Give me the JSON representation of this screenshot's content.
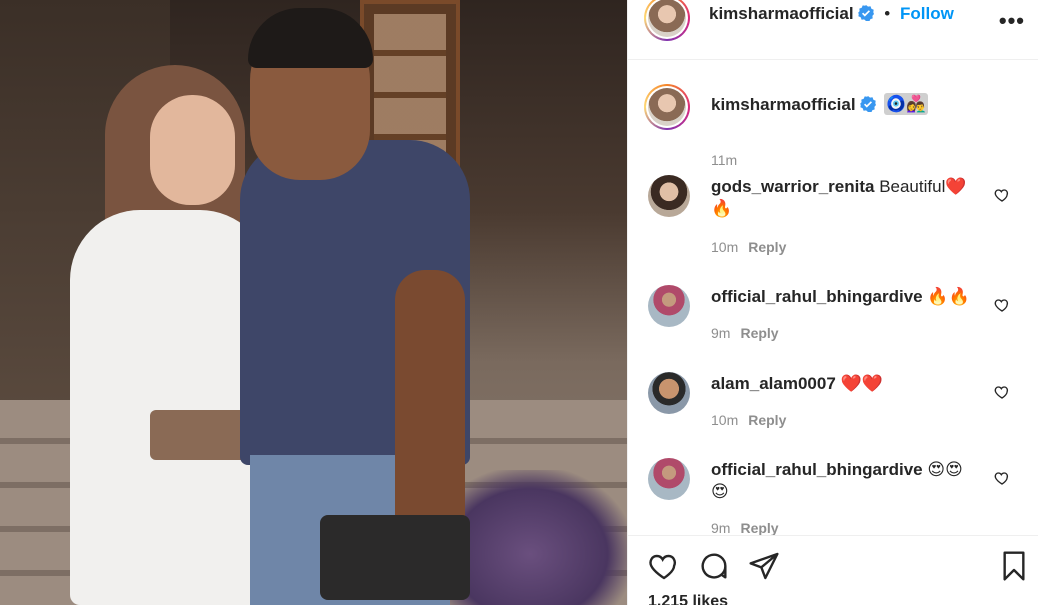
{
  "post": {
    "username": "kimsharmaofficial",
    "separator": "•",
    "follow_label": "Follow",
    "more_label": "•••"
  },
  "caption": {
    "username": "kimsharmaofficial",
    "emojis": "🧿👩‍❤️‍👨",
    "time": "11m"
  },
  "comments": [
    {
      "username": "gods_warrior_renita",
      "text": "Beautiful❤️🔥",
      "time": "10m",
      "reply_label": "Reply"
    },
    {
      "username": "official_rahul_bhingardive",
      "text": "🔥🔥",
      "time": "9m",
      "reply_label": "Reply"
    },
    {
      "username": "alam_alam0007",
      "text": "❤️❤️",
      "time": "10m",
      "reply_label": "Reply"
    },
    {
      "username": "official_rahul_bhingardive",
      "text": "😍😍😍",
      "time": "9m",
      "reply_label": "Reply"
    }
  ],
  "actions": {
    "icons": [
      "heart-icon",
      "comment-icon",
      "share-icon",
      "bookmark-icon"
    ]
  },
  "likes_text": "1,215 likes",
  "colors": {
    "follow": "#0095f6",
    "verified": "#3897f0",
    "meta": "#8e8e8e",
    "text": "#262626"
  }
}
